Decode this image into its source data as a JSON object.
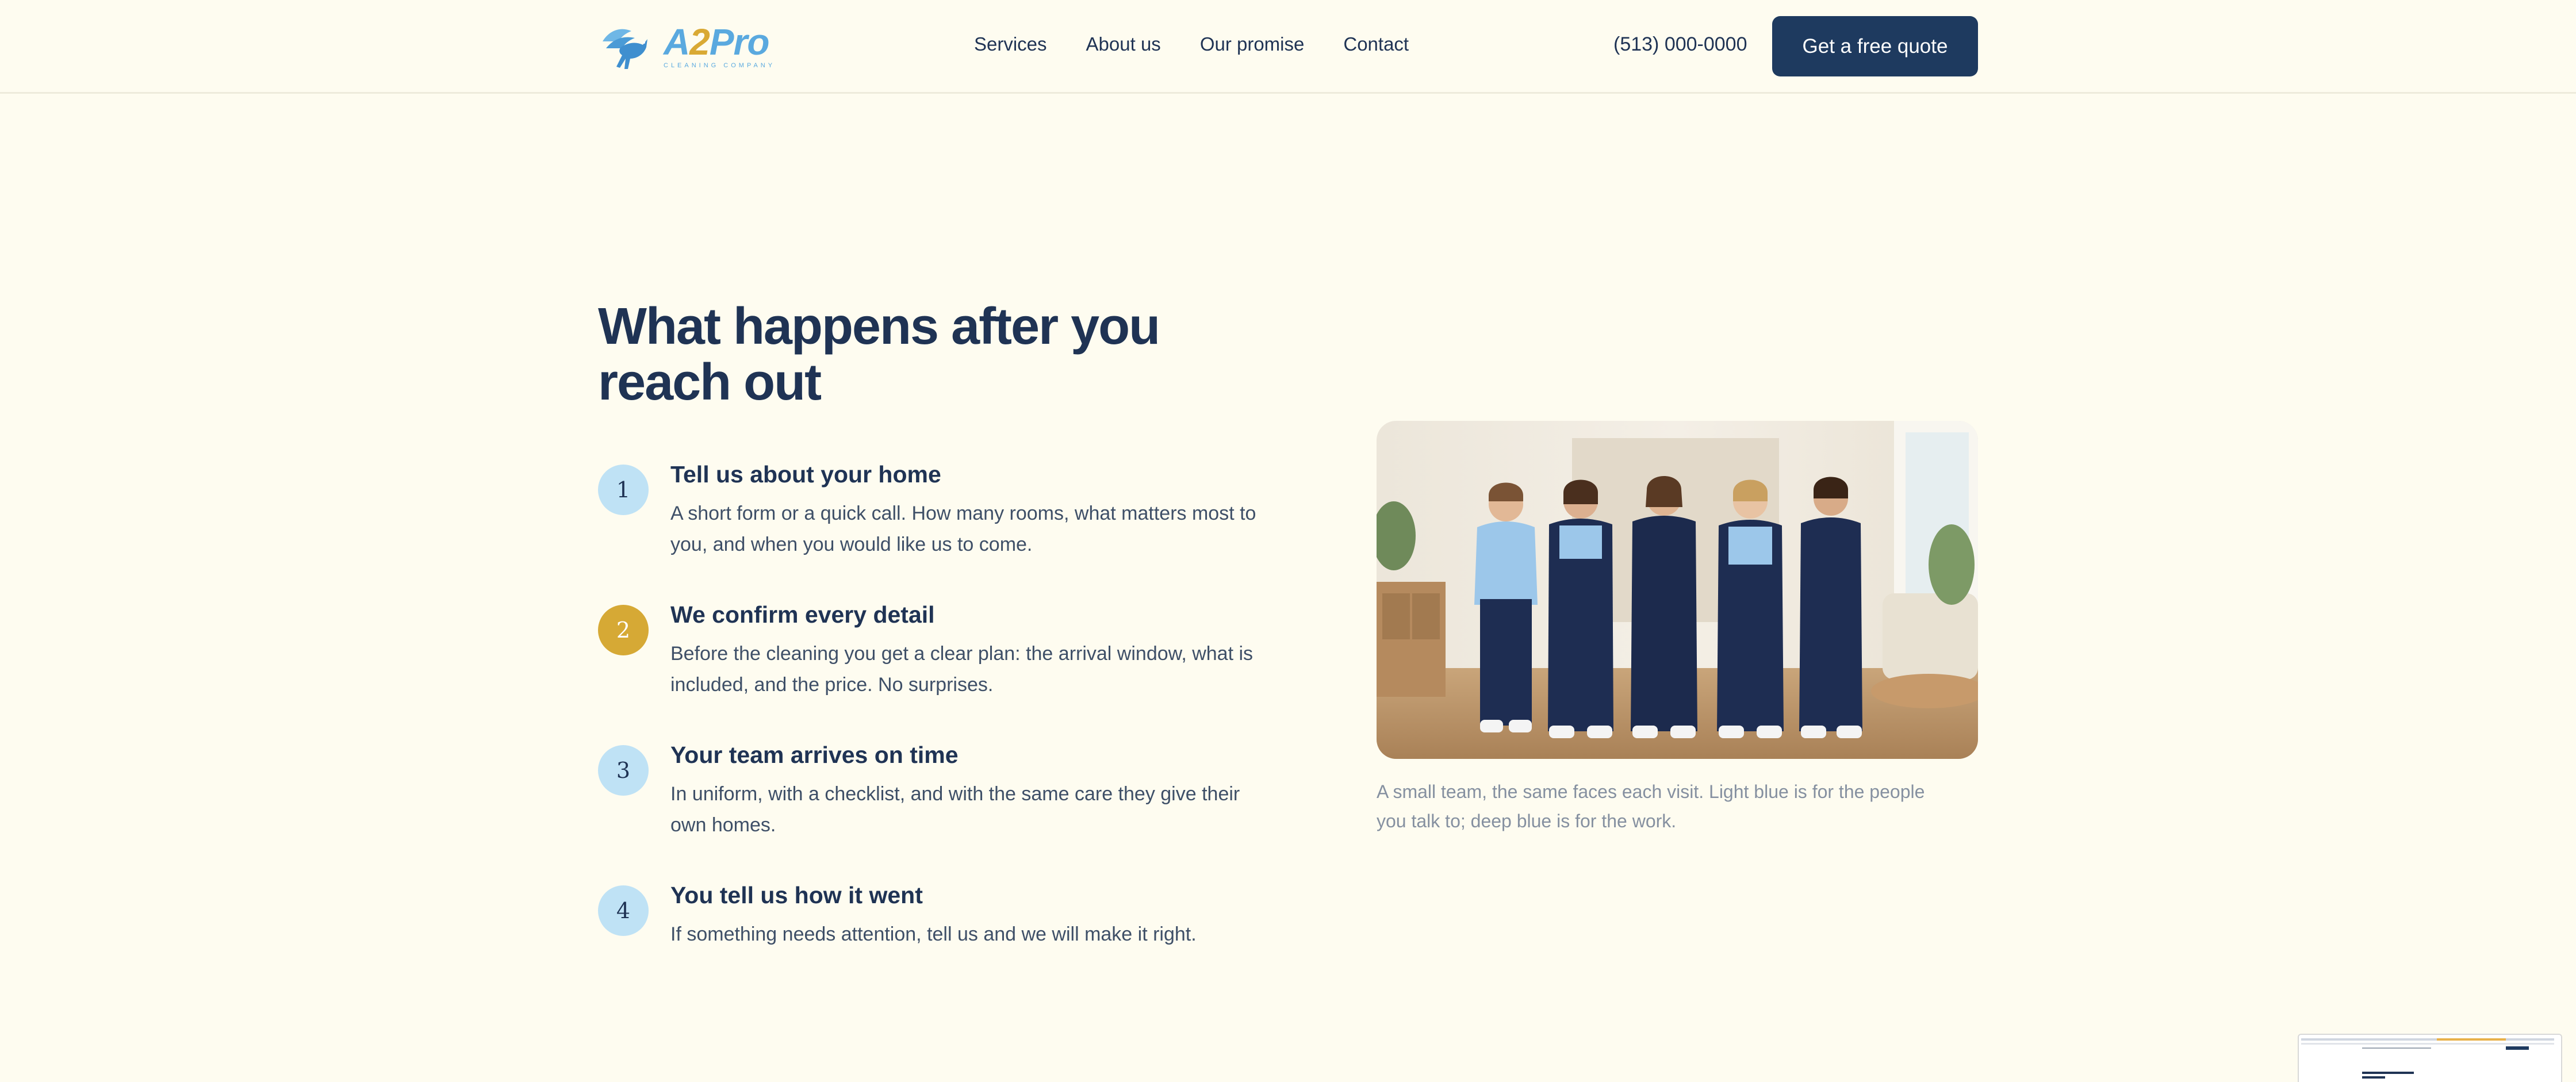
{
  "header": {
    "logo": {
      "brand_a": "A",
      "brand_2": "2",
      "brand_pro": "Pro",
      "tagline": "CLEANING COMPANY",
      "icon": "pegasus-icon"
    },
    "nav": [
      {
        "label": "Services"
      },
      {
        "label": "About us"
      },
      {
        "label": "Our promise"
      },
      {
        "label": "Contact"
      }
    ],
    "phone": "(513) 000-0000",
    "cta_label": "Get a free quote"
  },
  "main": {
    "title": "What happens after you reach out",
    "steps": [
      {
        "number": "1",
        "title": "Tell us about your home",
        "description": "A short form or a quick call. How many rooms, what matters most to you, and when you would like us to come."
      },
      {
        "number": "2",
        "title": "We confirm every detail",
        "description": "Before the cleaning you get a clear plan: the arrival window, what is included, and the price. No surprises."
      },
      {
        "number": "3",
        "title": "Your team arrives on time",
        "description": "In uniform, with a checklist, and with the same care they give their own homes."
      },
      {
        "number": "4",
        "title": "You tell us how it went",
        "description": "If something needs attention, tell us and we will make it right."
      }
    ],
    "photo_caption": "A small team, the same faces each visit. Light blue is for the people you talk to; deep blue is for the work."
  },
  "colors": {
    "background": "#fefcf0",
    "navy": "#1e3a5f",
    "light_blue": "#bfe2f5",
    "gold": "#d6a935"
  }
}
